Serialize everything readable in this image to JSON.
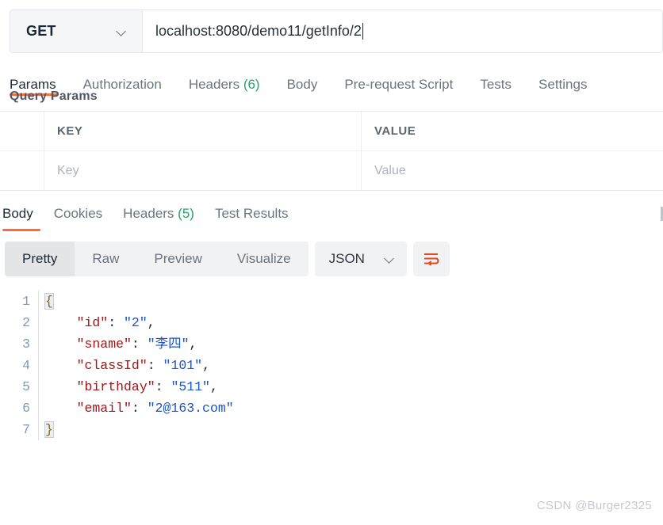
{
  "request": {
    "method": "GET",
    "method_chevron_icon": "chevron-down-icon",
    "url": "localhost:8080/demo11/getInfo/2",
    "tabs": [
      {
        "label": "Params",
        "active": true
      },
      {
        "label": "Authorization",
        "active": false
      },
      {
        "label": "Headers",
        "count": "(6)",
        "active": false
      },
      {
        "label": "Body",
        "active": false
      },
      {
        "label": "Pre-request Script",
        "active": false
      },
      {
        "label": "Tests",
        "active": false
      },
      {
        "label": "Settings",
        "active": false
      }
    ],
    "query_params_label": "Query Params",
    "params_table": {
      "headers": {
        "key": "KEY",
        "value": "VALUE"
      },
      "rows": [
        {
          "key_placeholder": "Key",
          "value_placeholder": "Value"
        }
      ]
    }
  },
  "response": {
    "tabs": [
      {
        "label": "Body",
        "active": true
      },
      {
        "label": "Cookies",
        "active": false
      },
      {
        "label": "Headers",
        "count": "(5)",
        "active": false
      },
      {
        "label": "Test Results",
        "active": false
      }
    ],
    "view_modes": [
      {
        "label": "Pretty",
        "active": true
      },
      {
        "label": "Raw",
        "active": false
      },
      {
        "label": "Preview",
        "active": false
      },
      {
        "label": "Visualize",
        "active": false
      }
    ],
    "format": "JSON",
    "format_chevron_icon": "chevron-down-icon",
    "wrap_button_icon": "word-wrap-icon",
    "body_lines": [
      {
        "num": "1",
        "tokens": [
          {
            "t": "brace",
            "s": "{"
          }
        ]
      },
      {
        "num": "2",
        "tokens": [
          {
            "t": "k",
            "s": "    \"id\""
          },
          {
            "t": "p",
            "s": ": "
          },
          {
            "t": "v",
            "s": "\"2\""
          },
          {
            "t": "p",
            "s": ","
          }
        ]
      },
      {
        "num": "3",
        "tokens": [
          {
            "t": "k",
            "s": "    \"sname\""
          },
          {
            "t": "p",
            "s": ": "
          },
          {
            "t": "v",
            "s": "\"李四\""
          },
          {
            "t": "p",
            "s": ","
          }
        ]
      },
      {
        "num": "4",
        "tokens": [
          {
            "t": "k",
            "s": "    \"classId\""
          },
          {
            "t": "p",
            "s": ": "
          },
          {
            "t": "v",
            "s": "\"101\""
          },
          {
            "t": "p",
            "s": ","
          }
        ]
      },
      {
        "num": "5",
        "tokens": [
          {
            "t": "k",
            "s": "    \"birthday\""
          },
          {
            "t": "p",
            "s": ": "
          },
          {
            "t": "v",
            "s": "\"511\""
          },
          {
            "t": "p",
            "s": ","
          }
        ]
      },
      {
        "num": "6",
        "tokens": [
          {
            "t": "k",
            "s": "    \"email\""
          },
          {
            "t": "p",
            "s": ": "
          },
          {
            "t": "v",
            "s": "\"2@163.com\""
          }
        ]
      },
      {
        "num": "7",
        "tokens": [
          {
            "t": "brace",
            "s": "}"
          }
        ]
      }
    ]
  },
  "watermark": "CSDN @Burger2325",
  "colors": {
    "accent": "#ff6c37",
    "count_green": "#23a26d",
    "json_key": "#a31515",
    "json_value": "#1a56c4",
    "line_number": "#7b9cb5"
  }
}
